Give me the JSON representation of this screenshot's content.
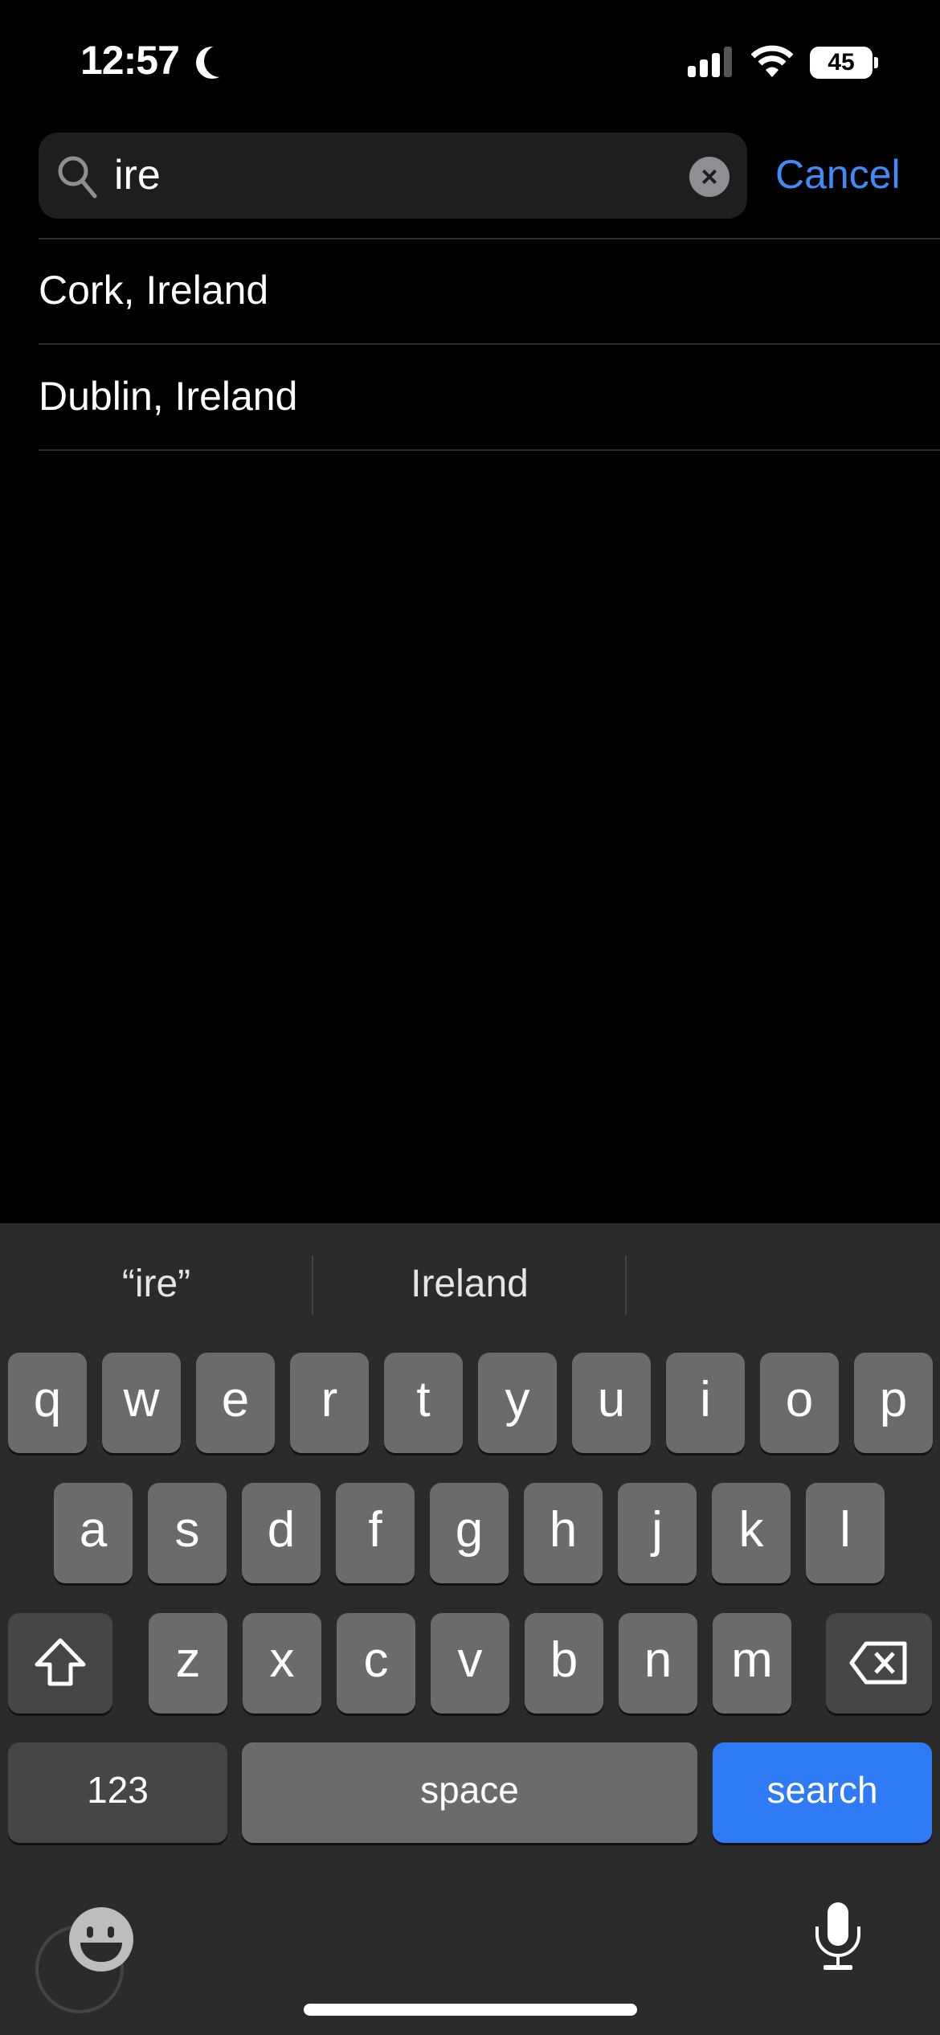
{
  "status": {
    "time": "12:57",
    "battery": "45",
    "icons": [
      "moon-icon",
      "cellular-signal-icon",
      "wifi-icon",
      "battery-icon"
    ]
  },
  "search": {
    "value": "ire",
    "cancel_label": "Cancel"
  },
  "results": [
    "Cork, Ireland",
    "Dublin, Ireland"
  ],
  "keyboard": {
    "suggestions": [
      "“ire”",
      "Ireland",
      ""
    ],
    "row1": [
      "q",
      "w",
      "e",
      "r",
      "t",
      "y",
      "u",
      "i",
      "o",
      "p"
    ],
    "row2": [
      "a",
      "s",
      "d",
      "f",
      "g",
      "h",
      "j",
      "k",
      "l"
    ],
    "row3": [
      "z",
      "x",
      "c",
      "v",
      "b",
      "n",
      "m"
    ],
    "numbers_label": "123",
    "space_label": "space",
    "search_label": "search"
  },
  "colors": {
    "accent": "#3f8cf7",
    "search_key": "#2f7bf5"
  }
}
